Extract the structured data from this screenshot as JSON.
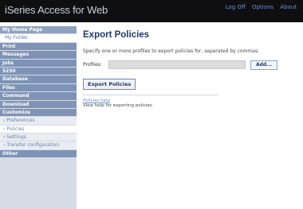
{
  "header": {
    "brand": "iSeries Access for Web",
    "links": [
      "Log Off",
      "Options",
      "About"
    ]
  },
  "sidebar": {
    "items": [
      {
        "label": "My Home Page",
        "type": "header-row"
      },
      {
        "label": "My Folder",
        "type": "myfolder"
      },
      {
        "label": "Print",
        "type": "main"
      },
      {
        "label": "Messages",
        "type": "main"
      },
      {
        "label": "Jobs",
        "type": "main"
      },
      {
        "label": "5250",
        "type": "main"
      },
      {
        "label": "Database",
        "type": "main"
      },
      {
        "label": "Files",
        "type": "main"
      },
      {
        "label": "Command",
        "type": "main"
      },
      {
        "label": "Download",
        "type": "main"
      },
      {
        "label": "Customize",
        "type": "main"
      },
      {
        "label": "› Preferences",
        "type": "sub"
      },
      {
        "label": "› Policies",
        "type": "current"
      },
      {
        "label": "› Settings",
        "type": "sub"
      },
      {
        "label": "› Transfer configuration",
        "type": "sub"
      },
      {
        "label": "Other",
        "type": "main"
      }
    ]
  },
  "main": {
    "title": "Export Policies",
    "instructions": "Specify one or more profiles to export policies for, separated by commas.",
    "profiles_label": "Profiles:",
    "profiles_value": "",
    "add_button": "Add...",
    "export_button": "Export Policies",
    "help_link": "Policies help",
    "help_text": "View help for exporting policies."
  },
  "colors": {
    "header_bg": "#0f0f12",
    "nav_bg": "#7e93b5",
    "title": "#1f3a6b",
    "link": "#6a8cc8"
  }
}
